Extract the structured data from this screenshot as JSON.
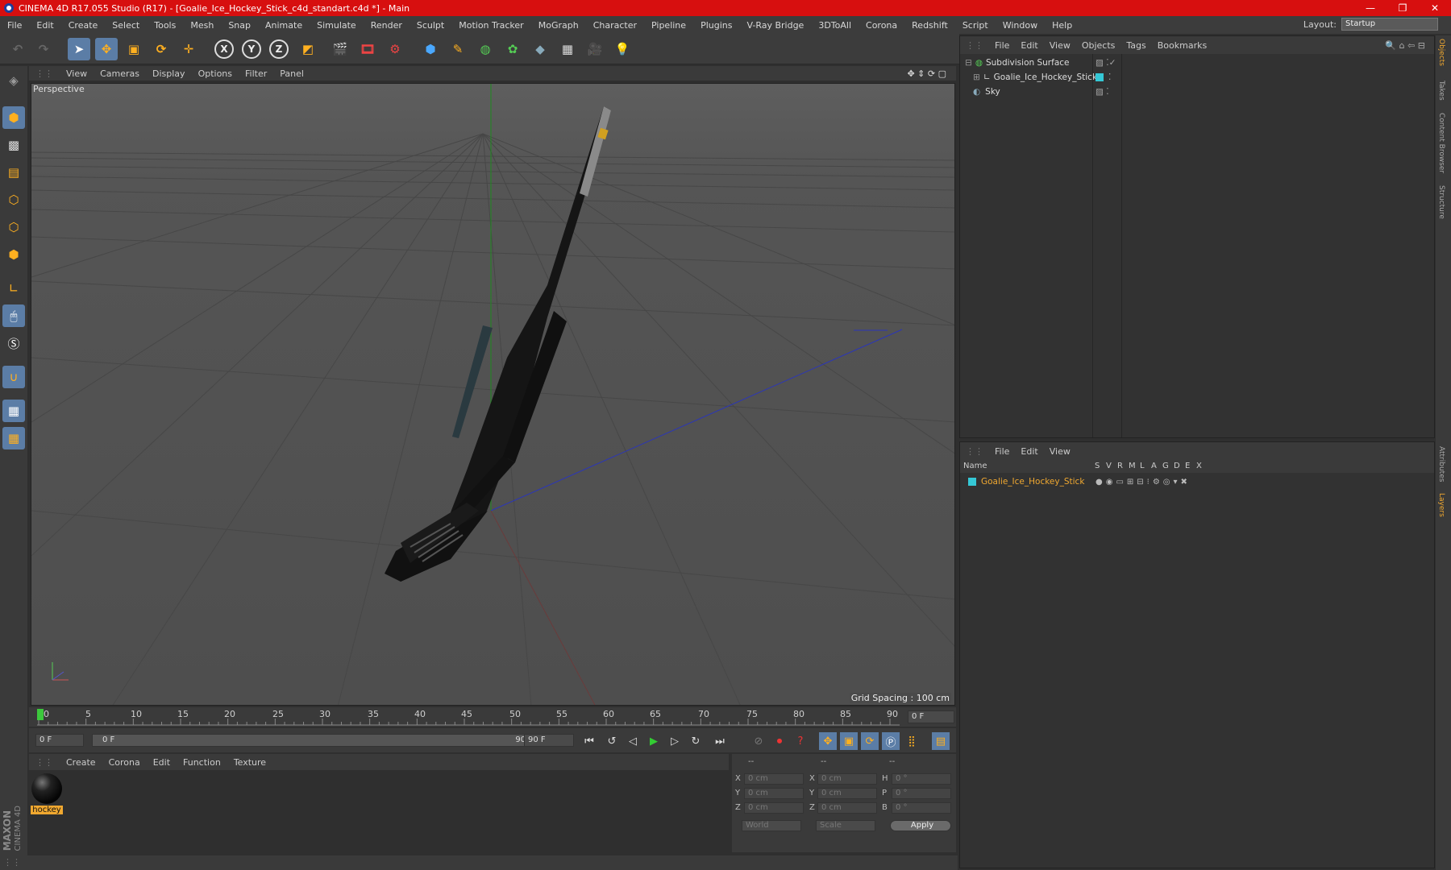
{
  "window": {
    "title": "CINEMA 4D R17.055 Studio (R17) - [Goalie_Ice_Hockey_Stick_c4d_standart.c4d *] - Main",
    "minimize": "—",
    "restore": "❐",
    "close": "✕"
  },
  "menu": [
    "File",
    "Edit",
    "Create",
    "Select",
    "Tools",
    "Mesh",
    "Snap",
    "Animate",
    "Simulate",
    "Render",
    "Sculpt",
    "Motion Tracker",
    "MoGraph",
    "Character",
    "Pipeline",
    "Plugins",
    "V-Ray Bridge",
    "3DToAll",
    "Corona",
    "Redshift",
    "Script",
    "Window",
    "Help"
  ],
  "layout": {
    "label": "Layout:",
    "value": "Startup"
  },
  "axes": {
    "x": "X",
    "y": "Y",
    "z": "Z"
  },
  "viewport": {
    "menu": [
      "View",
      "Cameras",
      "Display",
      "Options",
      "Filter",
      "Panel"
    ],
    "label": "Perspective",
    "grid_spacing": "Grid Spacing : 100 cm"
  },
  "timeline": {
    "ticks": [
      "0",
      "5",
      "10",
      "15",
      "20",
      "25",
      "30",
      "35",
      "40",
      "45",
      "50",
      "55",
      "60",
      "65",
      "70",
      "75",
      "80",
      "85",
      "90"
    ],
    "current_frame": "0 F",
    "start_field": "0 F",
    "range_start": "0 F",
    "range_end": "90 F",
    "end_field": "90 F"
  },
  "materials": {
    "menu": [
      "Create",
      "Corona",
      "Edit",
      "Function",
      "Texture"
    ],
    "items": [
      {
        "name": "hockey"
      }
    ]
  },
  "coords": {
    "headers": [
      "--",
      "--",
      "--"
    ],
    "rows": [
      {
        "a": "X",
        "av": "0 cm",
        "b": "X",
        "bv": "0 cm",
        "c": "H",
        "cv": "0 °"
      },
      {
        "a": "Y",
        "av": "0 cm",
        "b": "Y",
        "bv": "0 cm",
        "c": "P",
        "cv": "0 °"
      },
      {
        "a": "Z",
        "av": "0 cm",
        "b": "Z",
        "bv": "0 cm",
        "c": "B",
        "cv": "0 °"
      }
    ],
    "space": "World",
    "mode": "Scale",
    "apply": "Apply"
  },
  "objects": {
    "menu": [
      "File",
      "Edit",
      "View",
      "Objects",
      "Tags",
      "Bookmarks"
    ],
    "items": [
      {
        "name": "Subdivision Surface"
      },
      {
        "name": "Goalie_Ice_Hockey_Stick"
      },
      {
        "name": "Sky"
      }
    ]
  },
  "layers": {
    "menu": [
      "File",
      "Edit",
      "View"
    ],
    "columns": [
      "Name",
      "S",
      "V",
      "R",
      "M",
      "L",
      "A",
      "G",
      "D",
      "E",
      "X"
    ],
    "items": [
      {
        "name": "Goalie_Ice_Hockey_Stick"
      }
    ]
  },
  "right_tabs": [
    "Objects",
    "Takes",
    "Content Browser",
    "Structure",
    "Attributes",
    "Layers"
  ],
  "branding": {
    "maxon": "MAXON",
    "cinema": "CINEMA 4D"
  },
  "colors": {
    "title_bar": "#d70f0f",
    "selected": "#5b7da6",
    "layer_color": "#35c8d6",
    "highlight": "#f0a830"
  }
}
